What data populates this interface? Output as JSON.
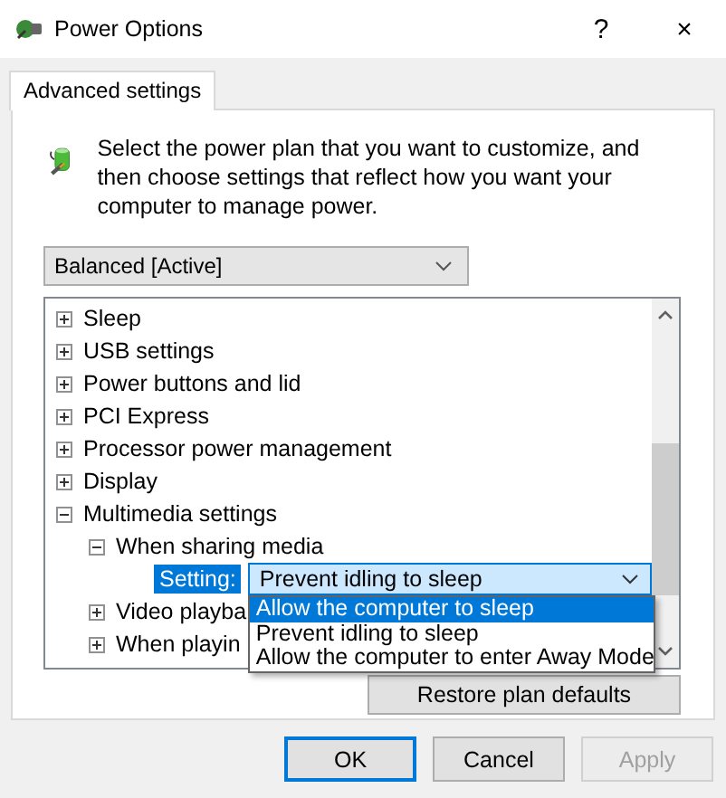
{
  "window": {
    "title": "Power Options",
    "help": "?",
    "close": "×"
  },
  "tabs": [
    {
      "label": "Advanced settings",
      "selected": true
    }
  ],
  "description": "Select the power plan that you want to customize, and then choose settings that reflect how you want your computer to manage power.",
  "plan_select": {
    "value": "Balanced [Active]"
  },
  "tree": [
    {
      "kind": "group",
      "label": "Sleep",
      "expanded": false
    },
    {
      "kind": "group",
      "label": "USB settings",
      "expanded": false
    },
    {
      "kind": "group",
      "label": "Power buttons and lid",
      "expanded": false
    },
    {
      "kind": "group",
      "label": "PCI Express",
      "expanded": false
    },
    {
      "kind": "group",
      "label": "Processor power management",
      "expanded": false
    },
    {
      "kind": "group",
      "label": "Display",
      "expanded": false
    },
    {
      "kind": "group",
      "label": "Multimedia settings",
      "expanded": true,
      "children": [
        {
          "kind": "group",
          "label": "When sharing media",
          "expanded": true,
          "children": [
            {
              "kind": "setting",
              "label": "Setting:",
              "value": "Prevent idling to sleep",
              "options": [
                {
                  "label": "Allow the computer to sleep",
                  "highlighted": true
                },
                {
                  "label": "Prevent idling to sleep",
                  "highlighted": false
                },
                {
                  "label": "Allow the computer to enter Away Mode",
                  "highlighted": false
                }
              ]
            }
          ]
        },
        {
          "kind": "group",
          "label": "Video playba",
          "expanded": false
        },
        {
          "kind": "group",
          "label": "When playin",
          "expanded": false
        }
      ]
    }
  ],
  "restore_button": "Restore plan defaults",
  "buttons": [
    {
      "label": "OK",
      "disabled": false,
      "default": true
    },
    {
      "label": "Cancel",
      "disabled": false,
      "default": false
    },
    {
      "label": "Apply",
      "disabled": true,
      "default": false
    }
  ]
}
